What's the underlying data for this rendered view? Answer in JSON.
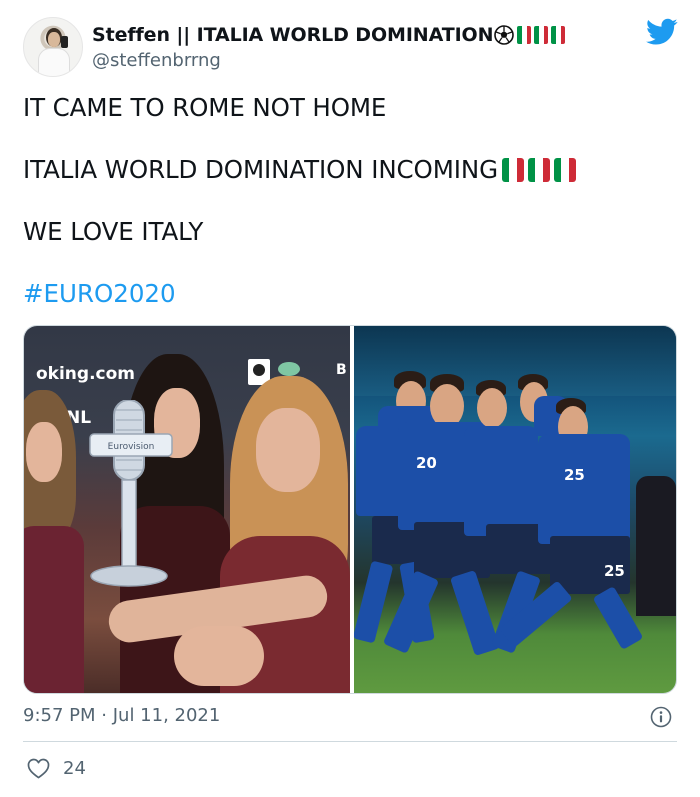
{
  "author": {
    "display_name": "Steffen || ITALIA WORLD DOMINATION",
    "handle": "@steffenbrrng",
    "name_icons": [
      "soccer-ball-icon",
      "italy-flag-icon",
      "italy-flag-icon",
      "italy-flag-icon"
    ]
  },
  "tweet": {
    "lines": [
      "IT CAME TO ROME NOT HOME",
      "ITALIA WORLD DOMINATION INCOMING",
      "WE LOVE ITALY"
    ],
    "hashtag": "#EURO2020"
  },
  "media": {
    "left_image": {
      "backdrop_text": "oking.com",
      "backdrop_country": "NL",
      "backdrop_letter": "B",
      "trophy_label": "Eurovision"
    },
    "right_image": {
      "shirt_numbers": [
        "20",
        "25",
        "25"
      ]
    }
  },
  "meta": {
    "time": "9:57 PM",
    "separator": "·",
    "date": "Jul 11, 2021",
    "likes": "24"
  },
  "colors": {
    "link": "#1d9bf0",
    "twitter_brand": "#1d9bf0",
    "secondary_text": "#536471",
    "italy_green": "#009246",
    "italy_red": "#ce2b37"
  }
}
